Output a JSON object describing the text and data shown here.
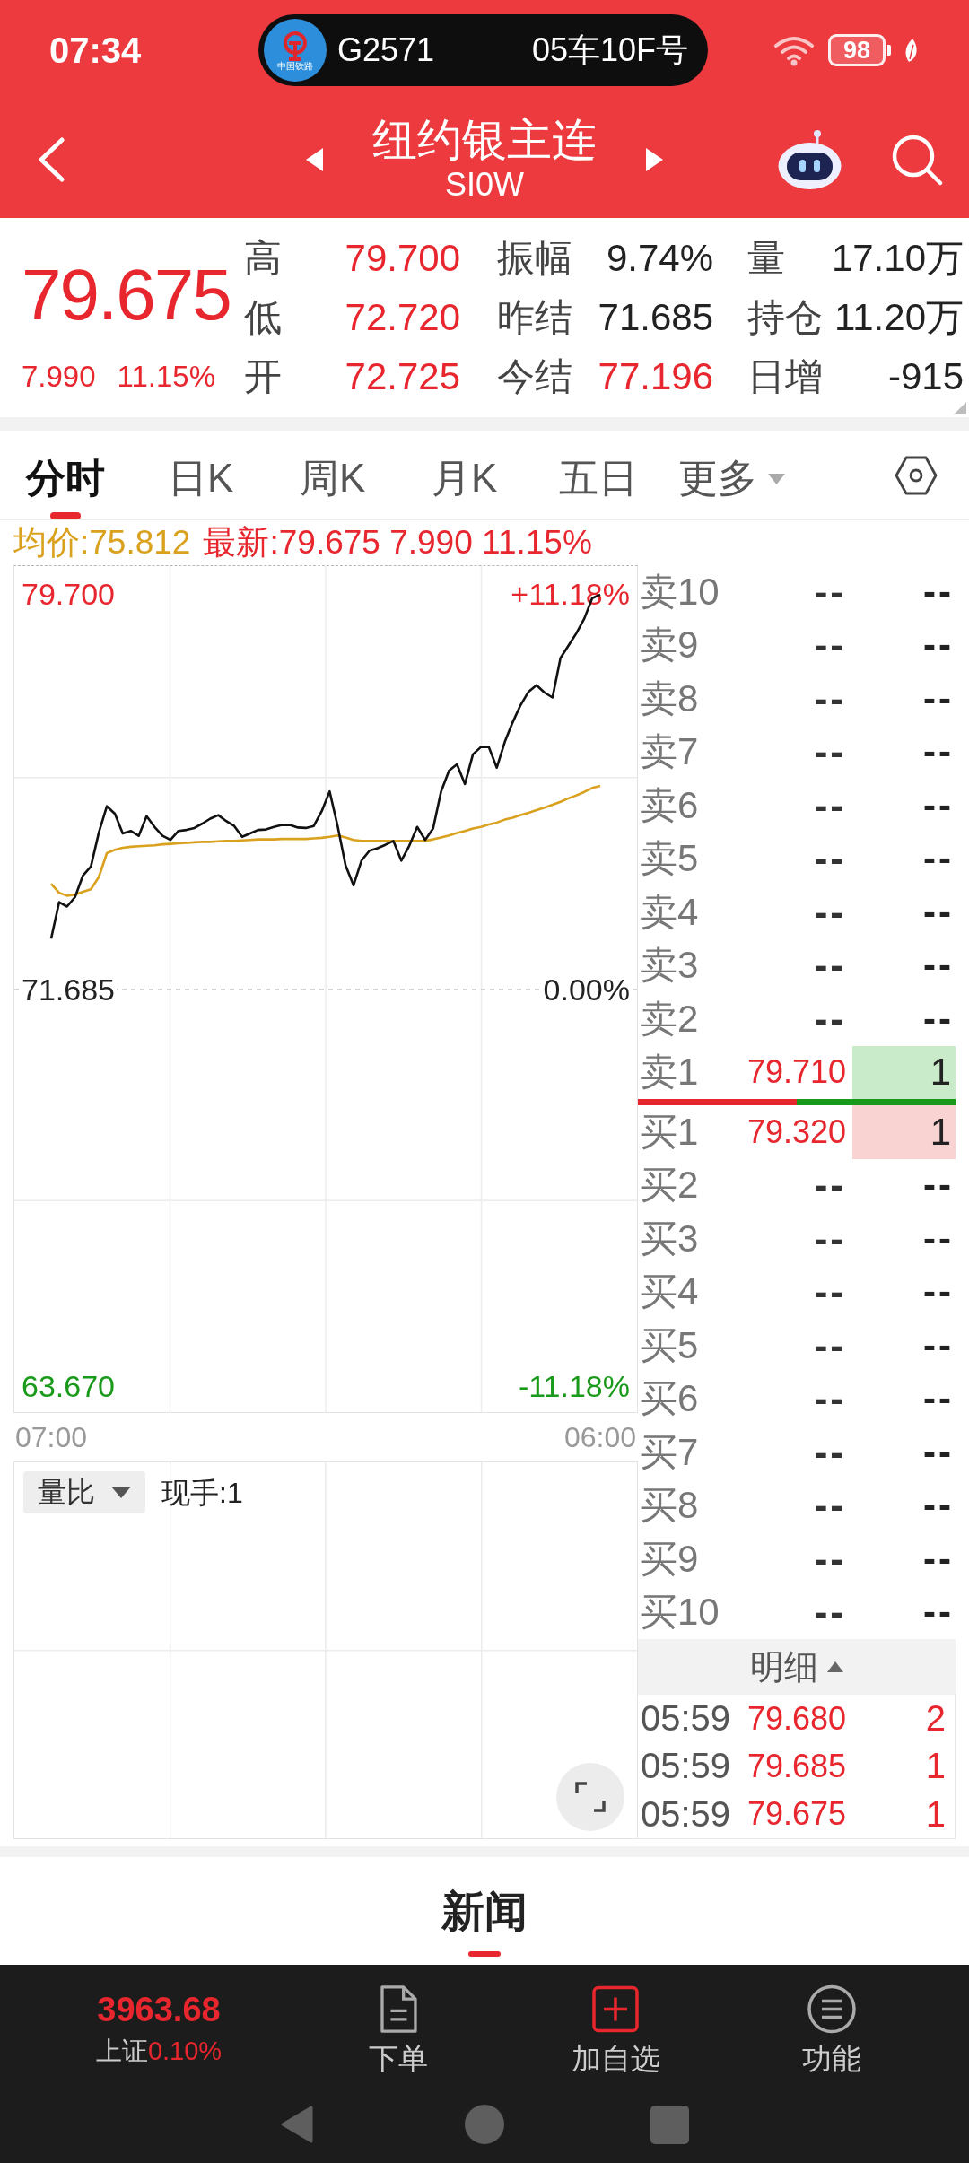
{
  "status_bar": {
    "time": "07:34",
    "ticket": {
      "logo_caption": "中国铁路",
      "train": "G2571",
      "seat": "05车10F号"
    },
    "battery": "98"
  },
  "header": {
    "title": "纽约银主连",
    "code": "SI0W"
  },
  "quote": {
    "price": "79.675",
    "change": "7.990",
    "change_pct": "11.15%",
    "stats": [
      {
        "label": "高",
        "value": "79.700",
        "color": "#e8262e"
      },
      {
        "label": "振幅",
        "value": "9.74%",
        "color": "#222222"
      },
      {
        "label": "量",
        "value": "17.10万",
        "color": "#222222"
      },
      {
        "label": "低",
        "value": "72.720",
        "color": "#e8262e"
      },
      {
        "label": "昨结",
        "value": "71.685",
        "color": "#222222"
      },
      {
        "label": "持仓",
        "value": "11.20万",
        "color": "#222222"
      },
      {
        "label": "开",
        "value": "72.725",
        "color": "#e8262e"
      },
      {
        "label": "今结",
        "value": "77.196",
        "color": "#e8262e"
      },
      {
        "label": "日增",
        "value": "-915",
        "color": "#222222"
      }
    ]
  },
  "tabs": [
    {
      "label": "分时",
      "selected": true,
      "kind": "tab"
    },
    {
      "label": "日K",
      "selected": false,
      "kind": "tab"
    },
    {
      "label": "周K",
      "selected": false,
      "kind": "tab"
    },
    {
      "label": "月K",
      "selected": false,
      "kind": "tab"
    },
    {
      "label": "五日",
      "selected": false,
      "kind": "tab"
    },
    {
      "label": "更多",
      "selected": false,
      "kind": "dropdown"
    }
  ],
  "chart": {
    "legend": [
      {
        "value": ":75.812",
        "color": "#d9a11d"
      },
      {
        "value": ":79.675 7.990 11.15%",
        "color": "#e8262e"
      }
    ],
    "right_labels": [
      "+11.18%",
      "0.00%",
      "-11.18%"
    ],
    "chart_data": {
      "type": "line",
      "categories": [
        "07:00",
        null,
        null,
        null,
        null,
        null,
        null,
        null,
        null,
        null,
        null,
        null,
        null,
        null,
        null,
        null,
        null,
        null,
        null,
        null,
        null,
        null,
        null,
        null,
        null,
        null,
        null,
        null,
        null,
        null,
        null,
        null,
        null,
        null,
        null,
        null,
        null,
        null,
        null,
        null,
        null,
        null,
        null,
        null,
        null,
        null,
        null,
        null,
        null,
        null,
        null,
        null,
        null,
        null,
        null,
        null,
        null,
        null,
        null,
        null,
        null,
        null,
        null,
        null,
        null,
        null,
        null,
        null,
        null,
        "06:00"
      ],
      "series": [
        {
          "name": "均价",
          "color": "#d9a11d",
          "values": [
            73.83,
            73.65,
            73.59,
            73.61,
            73.67,
            73.72,
            73.97,
            74.45,
            74.52,
            74.56,
            74.58,
            74.59,
            74.6,
            74.61,
            74.63,
            74.64,
            74.65,
            74.66,
            74.67,
            74.68,
            74.68,
            74.69,
            74.7,
            74.7,
            74.71,
            74.72,
            74.73,
            74.73,
            74.73,
            74.74,
            74.74,
            74.74,
            74.74,
            74.75,
            74.76,
            74.78,
            74.81,
            74.77,
            74.72,
            74.7,
            74.7,
            74.7,
            74.7,
            74.7,
            74.7,
            74.7,
            74.7,
            74.7,
            74.73,
            74.77,
            74.81,
            74.86,
            74.9,
            74.95,
            74.98,
            75.03,
            75.07,
            75.13,
            75.17,
            75.22,
            75.27,
            75.32,
            75.37,
            75.43,
            75.49,
            75.56,
            75.62,
            75.69,
            75.77,
            75.81
          ]
        },
        {
          "name": "最新",
          "color": "#111111",
          "values": [
            72.72,
            73.46,
            73.37,
            73.56,
            74.0,
            74.18,
            74.87,
            75.4,
            75.25,
            74.85,
            74.9,
            74.8,
            75.2,
            74.98,
            74.8,
            74.72,
            74.9,
            74.92,
            74.96,
            75.05,
            75.15,
            75.22,
            75.1,
            75.0,
            74.78,
            74.85,
            74.92,
            74.93,
            74.98,
            75.02,
            75.02,
            74.97,
            74.96,
            75.0,
            75.3,
            75.7,
            75.0,
            74.2,
            73.8,
            74.3,
            74.5,
            74.55,
            74.62,
            74.7,
            74.3,
            74.6,
            74.98,
            74.72,
            74.95,
            75.7,
            76.12,
            76.25,
            75.85,
            76.45,
            76.6,
            76.6,
            76.18,
            76.7,
            77.1,
            77.45,
            77.72,
            77.85,
            77.7,
            77.6,
            78.4,
            78.65,
            78.9,
            79.2,
            79.61,
            79.68
          ]
        }
      ],
      "ylim": [
        63.14,
        80.26
      ],
      "yticks": [
        {
          "value": 79.7,
          "label": "79.700"
        },
        {
          "value": 71.685,
          "label": "71.685"
        },
        {
          "value": 63.67,
          "label": "63.670"
        }
      ],
      "ref_lines": [
        {
          "axis": "y",
          "value": 71.685
        }
      ]
    }
  },
  "volume_panel": {
    "selector": "量比",
    "current": "现手:1"
  },
  "order_book": {
    "asks": [
      {
        "label": "卖10",
        "price": "--",
        "volume": "--",
        "kind": "empty"
      },
      {
        "label": "卖9",
        "price": "--",
        "volume": "--",
        "kind": "empty"
      },
      {
        "label": "卖8",
        "price": "--",
        "volume": "--",
        "kind": "empty"
      },
      {
        "label": "卖7",
        "price": "--",
        "volume": "--",
        "kind": "empty"
      },
      {
        "label": "卖6",
        "price": "--",
        "volume": "--",
        "kind": "empty"
      },
      {
        "label": "卖5",
        "price": "--",
        "volume": "--",
        "kind": "empty"
      },
      {
        "label": "卖4",
        "price": "--",
        "volume": "--",
        "kind": "empty"
      },
      {
        "label": "卖3",
        "price": "--",
        "volume": "--",
        "kind": "empty"
      },
      {
        "label": "卖2",
        "price": "--",
        "volume": "--",
        "kind": "empty"
      },
      {
        "label": "卖1",
        "price": "79.710",
        "volume": "1",
        "kind": "quote"
      }
    ],
    "ratio_bar": {
      "level": 0.5
    },
    "bids": [
      {
        "label": "买1",
        "price": "79.320",
        "volume": "1",
        "kind": "quote"
      },
      {
        "label": "买2",
        "price": "--",
        "volume": "--",
        "kind": "empty"
      },
      {
        "label": "买3",
        "price": "--",
        "volume": "--",
        "kind": "empty"
      },
      {
        "label": "买4",
        "price": "--",
        "volume": "--",
        "kind": "empty"
      },
      {
        "label": "买5",
        "price": "--",
        "volume": "--",
        "kind": "empty"
      },
      {
        "label": "买6",
        "price": "--",
        "volume": "--",
        "kind": "empty"
      },
      {
        "label": "买7",
        "price": "--",
        "volume": "--",
        "kind": "empty"
      },
      {
        "label": "买8",
        "price": "--",
        "volume": "--",
        "kind": "empty"
      },
      {
        "label": "买9",
        "price": "--",
        "volume": "--",
        "kind": "empty"
      },
      {
        "label": "买10",
        "price": "--",
        "volume": "--",
        "kind": "empty"
      }
    ],
    "detail_header": "明细",
    "trades": [
      {
        "time": "05:59",
        "price": "79.680",
        "volume": "2"
      },
      {
        "time": "05:59",
        "price": "79.685",
        "volume": "1"
      },
      {
        "time": "05:59",
        "price": "79.675",
        "volume": "1"
      }
    ]
  },
  "section_tabs": [
    {
      "label": "新闻",
      "selected": true
    }
  ],
  "bottom_bar": {
    "index": {
      "value": "3963.68",
      "name": "上证",
      "change": "0.10%"
    },
    "items": [
      {
        "label": "下单",
        "kind": "order"
      },
      {
        "label": "加自选",
        "kind": "watchlist"
      },
      {
        "label": "功能",
        "kind": "functions"
      }
    ]
  }
}
